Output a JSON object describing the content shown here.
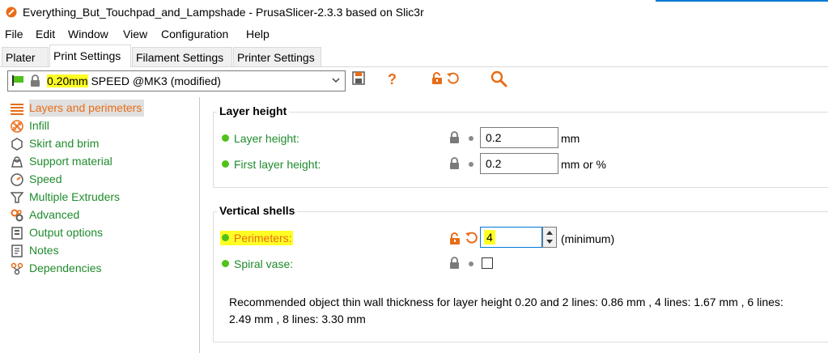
{
  "window": {
    "title": "Everything_But_Touchpad_and_Lampshade - PrusaSlicer-2.3.3 based on Slic3r"
  },
  "menu": [
    "File",
    "Edit",
    "Window",
    "View",
    "Configuration",
    "Help"
  ],
  "tabs": [
    "Plater",
    "Print Settings",
    "Filament Settings",
    "Printer Settings"
  ],
  "preset": {
    "highlight": "0.20mm",
    "rest": " SPEED @MK3 (modified)"
  },
  "sidebar": {
    "items": [
      {
        "label": "Layers and perimeters",
        "icon": "layers-icon"
      },
      {
        "label": "Infill",
        "icon": "infill-icon"
      },
      {
        "label": "Skirt and brim",
        "icon": "skirt-icon"
      },
      {
        "label": "Support material",
        "icon": "support-icon"
      },
      {
        "label": "Speed",
        "icon": "speed-icon"
      },
      {
        "label": "Multiple Extruders",
        "icon": "extruder-icon"
      },
      {
        "label": "Advanced",
        "icon": "advanced-icon"
      },
      {
        "label": "Output options",
        "icon": "output-icon"
      },
      {
        "label": "Notes",
        "icon": "notes-icon"
      },
      {
        "label": "Dependencies",
        "icon": "dependencies-icon"
      }
    ]
  },
  "layer_height": {
    "title": "Layer height",
    "layer_height_label": "Layer height:",
    "layer_height_value": "0.2",
    "layer_height_unit": "mm",
    "first_layer_label": "First layer height:",
    "first_layer_value": "0.2",
    "first_layer_unit": "mm or %"
  },
  "vertical_shells": {
    "title": "Vertical shells",
    "perimeters_label": "Perimeters:",
    "perimeters_value": "4",
    "perimeters_unit": "(minimum)",
    "spiral_label": "Spiral vase:",
    "note_line1": "Recommended object thin wall thickness for layer height 0.20 and 2 lines: 0.86 mm , 4 lines: 1.67 mm , 6 lines:",
    "note_line2": "2.49 mm , 8 lines: 3.30 mm"
  },
  "colors": {
    "accent_orange": "#e86c17",
    "green": "#1f8b2c",
    "highlight": "#ffff26"
  }
}
